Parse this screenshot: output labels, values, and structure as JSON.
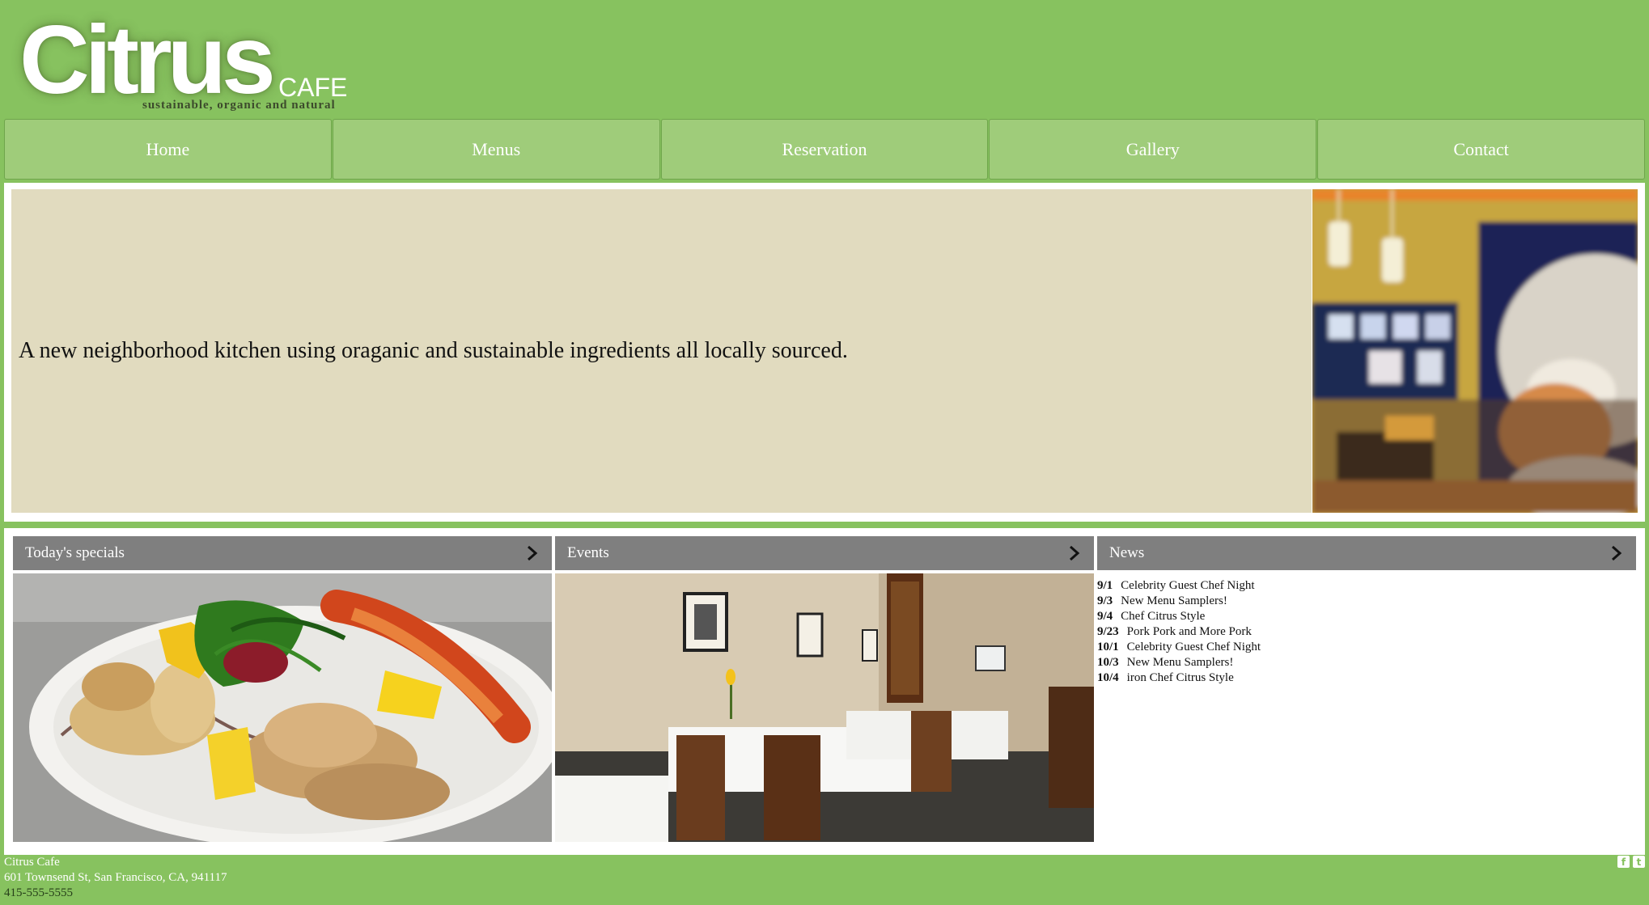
{
  "logo": {
    "main": "Citrus",
    "sub": "CAFE",
    "tagline": "sustainable, organic and natural"
  },
  "nav": {
    "items": [
      {
        "label": "Home"
      },
      {
        "label": "Menus"
      },
      {
        "label": "Reservation"
      },
      {
        "label": "Gallery"
      },
      {
        "label": "Contact"
      }
    ]
  },
  "hero": {
    "text": "A new neighborhood kitchen using oraganic and sustainable ingredients all locally sourced."
  },
  "panels": {
    "specials": {
      "title": "Today's specials"
    },
    "events": {
      "title": "Events"
    },
    "news": {
      "title": "News",
      "items": [
        {
          "date": "9/1",
          "text": "Celebrity Guest Chef Night"
        },
        {
          "date": "9/3",
          "text": "New Menu Samplers!"
        },
        {
          "date": "9/4",
          "text": "Chef Citrus Style"
        },
        {
          "date": "9/23",
          "text": "Pork Pork and More Pork"
        },
        {
          "date": "10/1",
          "text": "Celebrity Guest Chef Night"
        },
        {
          "date": "10/3",
          "text": "New Menu Samplers!"
        },
        {
          "date": "10/4",
          "text": "iron Chef Citrus Style"
        }
      ]
    }
  },
  "footer": {
    "name": "Citrus Cafe",
    "address": "601 Townsend St, San Francisco, CA, 941117",
    "phone": "415-555-5555"
  },
  "social": [
    {
      "icon": "facebook-icon",
      "glyph": "f"
    },
    {
      "icon": "twitter-icon",
      "glyph": "t"
    }
  ],
  "colors": {
    "background": "#87c25f",
    "nav": "#9fcc7a",
    "hero_box": "#e1dbbf",
    "panel_header": "#7f7f7f"
  }
}
